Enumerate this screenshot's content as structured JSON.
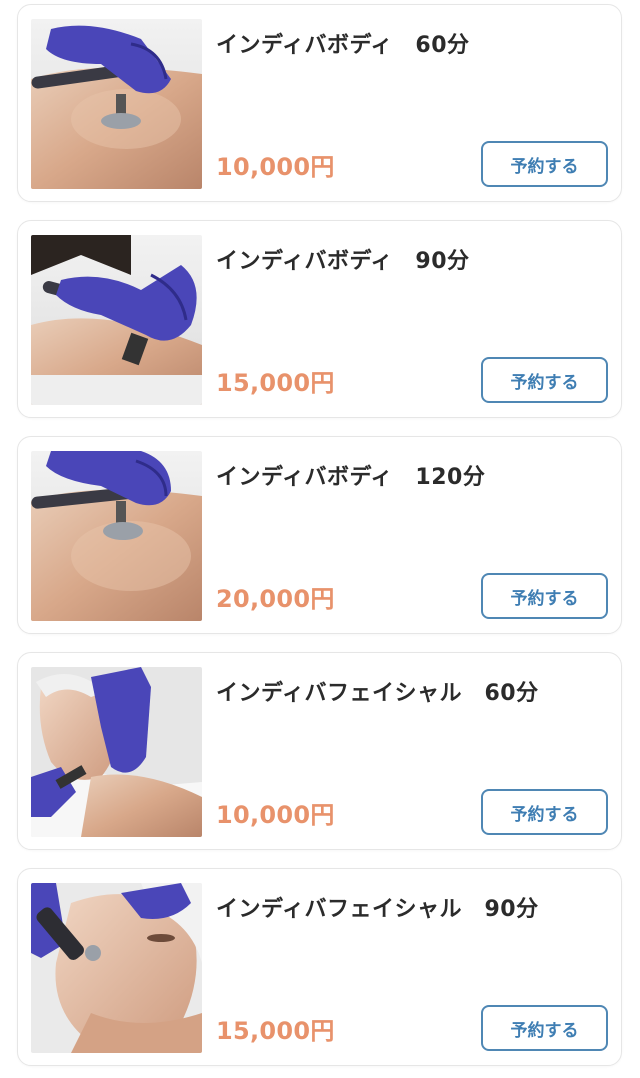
{
  "menu_items": [
    {
      "title": "インディバボディ　60分",
      "price": "10,000円",
      "button_label": "予約する",
      "image": "body-treatment-photo"
    },
    {
      "title": "インディバボディ　90分",
      "price": "15,000円",
      "button_label": "予約する",
      "image": "body-treatment-photo"
    },
    {
      "title": "インディバボディ　120分",
      "price": "20,000円",
      "button_label": "予約する",
      "image": "body-treatment-photo"
    },
    {
      "title": "インディバフェイシャル　60分",
      "price": "10,000円",
      "button_label": "予約する",
      "image": "facial-treatment-photo"
    },
    {
      "title": "インディバフェイシャル　90分",
      "price": "15,000円",
      "button_label": "予約する",
      "image": "facial-treatment-photo"
    }
  ],
  "colors": {
    "price": "#e8926b",
    "button_border": "#4f87b4",
    "button_text": "#3f7eb3",
    "glove": "#4a46b8"
  }
}
